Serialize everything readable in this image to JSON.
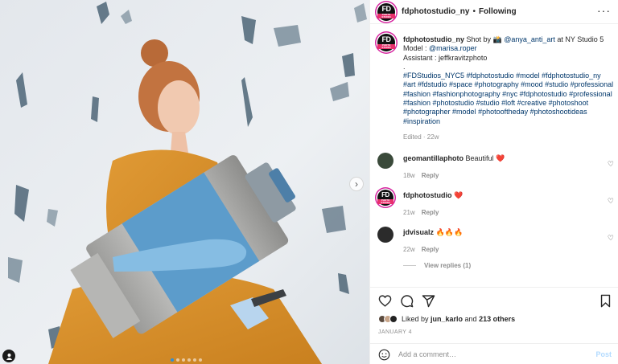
{
  "post": {
    "username": "fdphotostudio_ny",
    "separator": "•",
    "follow_status": "Following",
    "avatar_text": "FD",
    "avatar_subtext": "PHOTO STUDIO",
    "more_icon": "more-horizontal-icon"
  },
  "caption": {
    "username": "fdphotostudio_ny",
    "line1_text": " Shot by 📸 ",
    "line1_mention": "@anya_anti_art",
    "line1_tail": " at NY Studio 5",
    "model_label": "Model : ",
    "model_mention": "@marisa.roper",
    "assistant_line": "Assistant : jeffkravitzphoto",
    "dot_line": ".",
    "hashtags": "#FDStudios_NYC5 #fdphotostudio #model #fdphotostudio_ny #art #fdstudio #space #photography #mood #studio #professional #fashion #fashionphotography #nyc #fdphotostudio #professional #fashion #photostudio #studio #loft #creative #photoshoot #photographer #model #photooftheday #photoshootideas #inspiration",
    "edited": "Edited · 22w"
  },
  "comments": [
    {
      "username": "geomantillaphoto",
      "text": " Beautiful ",
      "emoji": "❤️",
      "time": "18w",
      "reply": "Reply"
    },
    {
      "username": "fdphotostudio",
      "text": " ",
      "emoji": "❤️",
      "time": "21w",
      "reply": "Reply"
    },
    {
      "username": "jdvisualz",
      "text": " ",
      "emoji": "🔥🔥🔥",
      "time": "22w",
      "reply": "Reply"
    }
  ],
  "view_replies": "View replies (1)",
  "likes": {
    "prefix": "Liked by ",
    "user": "jun_karlo",
    "middle": " and ",
    "others": "213 others"
  },
  "date": "JANUARY 4",
  "add_comment": {
    "placeholder": "Add a comment…",
    "post_label": "Post"
  },
  "icons": {
    "like": "heart-icon",
    "comment": "comment-icon",
    "share": "share-icon",
    "save": "bookmark-icon",
    "emoji": "emoji-icon",
    "next": "chevron-right-icon",
    "tag": "user-tag-icon"
  },
  "carousel": {
    "total": 6,
    "active": 0
  },
  "colors": {
    "accent_link": "#00376b",
    "post_button_disabled": "#b3dbff",
    "heart_red": "#ed4956",
    "story_ring": "#d6249f",
    "carousel_active": "#2f8fd4"
  }
}
